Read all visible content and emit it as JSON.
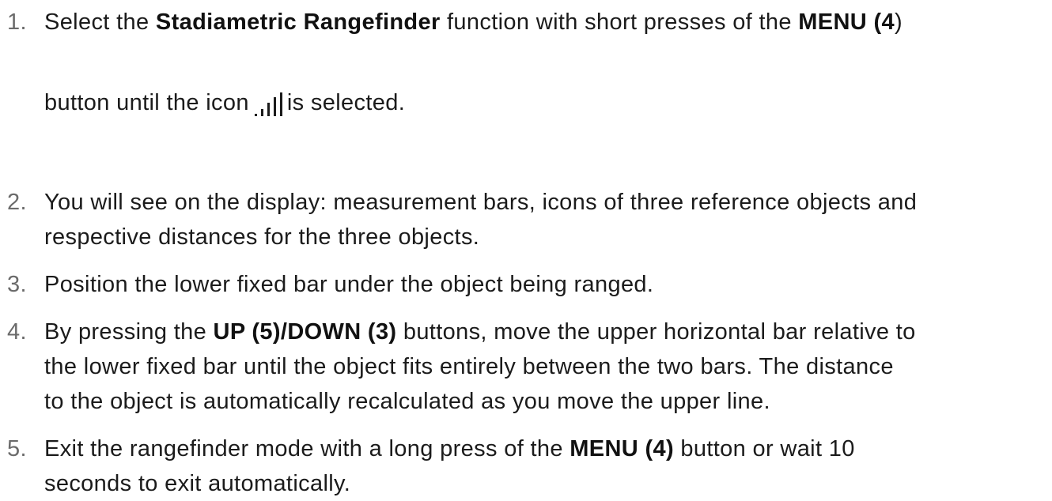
{
  "steps": [
    {
      "number": "1.",
      "lines": [
        {
          "t1": "Select the ",
          "b1": "Stadiametric Rangefinder",
          "t2": " function with short presses of the ",
          "b2": "MENU (4",
          "t3": ")"
        },
        {
          "t1": "button until the icon",
          "icon": "signal-bars-icon",
          "t2": "is selected."
        }
      ]
    },
    {
      "number": "2.",
      "lines": [
        "You will see on the display: measurement bars, icons of three reference objects and",
        "respective distances for the three objects."
      ]
    },
    {
      "number": "3.",
      "lines": [
        "Position the lower fixed bar under the object being ranged."
      ]
    },
    {
      "number": "4.",
      "lines": [
        {
          "t1": "By pressing the ",
          "b1": "UP (5)/DOWN (3)",
          "t2": " buttons, move the upper horizontal bar relative to"
        },
        "the lower fixed bar until the object fits entirely between the two bars. The distance",
        "to the object is automatically recalculated as you move the upper line."
      ]
    },
    {
      "number": "5.",
      "lines": [
        {
          "t1": "Exit the rangefinder mode with a long press of the ",
          "b1": "MENU (4)",
          "t2": " button or wait 10"
        },
        "seconds to exit automatically."
      ]
    }
  ]
}
